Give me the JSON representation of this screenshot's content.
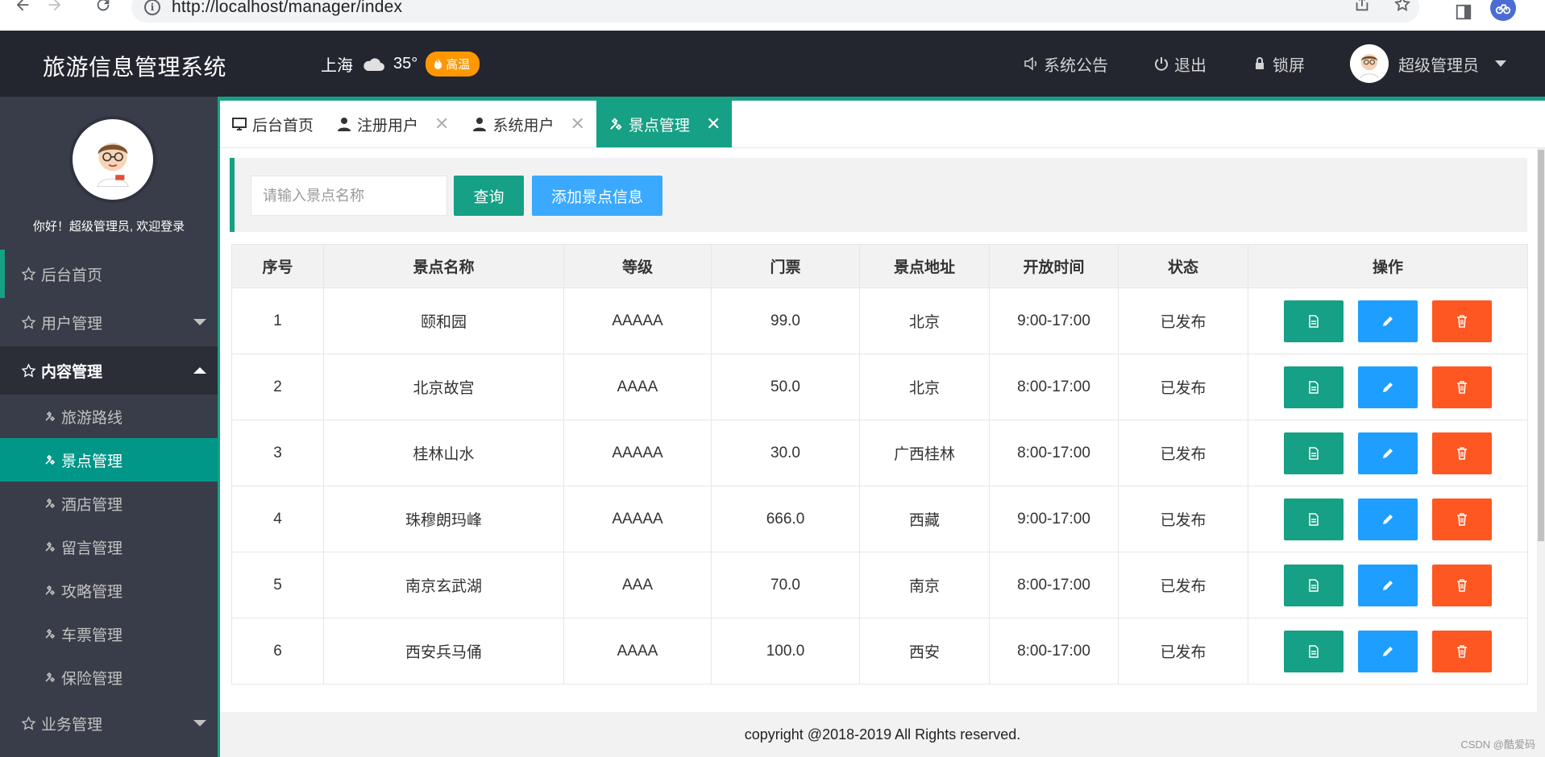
{
  "browser": {
    "url": "http://localhost/manager/index"
  },
  "header": {
    "title": "旅游信息管理系统",
    "weather": {
      "city": "上海",
      "temperature": "35°",
      "badge": "高温"
    },
    "announcement": "系统公告",
    "logout": "退出",
    "lock": "锁屏",
    "user": "超级管理员"
  },
  "sidebar": {
    "welcome": "你好！超级管理员, 欢迎登录",
    "menu": [
      {
        "label": "后台首页"
      },
      {
        "label": "用户管理"
      },
      {
        "label": "内容管理"
      },
      {
        "label": "业务管理"
      }
    ],
    "submenu": [
      {
        "label": "旅游路线"
      },
      {
        "label": "景点管理"
      },
      {
        "label": "酒店管理"
      },
      {
        "label": "留言管理"
      },
      {
        "label": "攻略管理"
      },
      {
        "label": "车票管理"
      },
      {
        "label": "保险管理"
      }
    ]
  },
  "tabs": [
    {
      "label": "后台首页"
    },
    {
      "label": "注册用户"
    },
    {
      "label": "系统用户"
    },
    {
      "label": "景点管理"
    }
  ],
  "toolbar": {
    "search_placeholder": "请输入景点名称",
    "query_label": "查询",
    "add_label": "添加景点信息"
  },
  "table": {
    "headers": [
      "序号",
      "景点名称",
      "等级",
      "门票",
      "景点地址",
      "开放时间",
      "状态",
      "操作"
    ],
    "rows": [
      [
        "1",
        "颐和园",
        "AAAAA",
        "99.0",
        "北京",
        "9:00-17:00",
        "已发布"
      ],
      [
        "2",
        "北京故宫",
        "AAAA",
        "50.0",
        "北京",
        "8:00-17:00",
        "已发布"
      ],
      [
        "3",
        "桂林山水",
        "AAAAA",
        "30.0",
        "广西桂林",
        "8:00-17:00",
        "已发布"
      ],
      [
        "4",
        "珠穆朗玛峰",
        "AAAAA",
        "666.0",
        "西藏",
        "9:00-17:00",
        "已发布"
      ],
      [
        "5",
        "南京玄武湖",
        "AAA",
        "70.0",
        "南京",
        "8:00-17:00",
        "已发布"
      ],
      [
        "6",
        "西安兵马俑",
        "AAAA",
        "100.0",
        "西安",
        "8:00-17:00",
        "已发布"
      ]
    ]
  },
  "footer": {
    "copyright": "copyright @2018-2019 All Rights reserved."
  },
  "watermark": "CSDN @酷爱码",
  "colors": {
    "accent": "#16a085",
    "header_bg": "#23262e",
    "sidebar_bg": "#393d49",
    "edit": "#1e9fff",
    "delete": "#ff5722",
    "hot": "#ff9800"
  }
}
